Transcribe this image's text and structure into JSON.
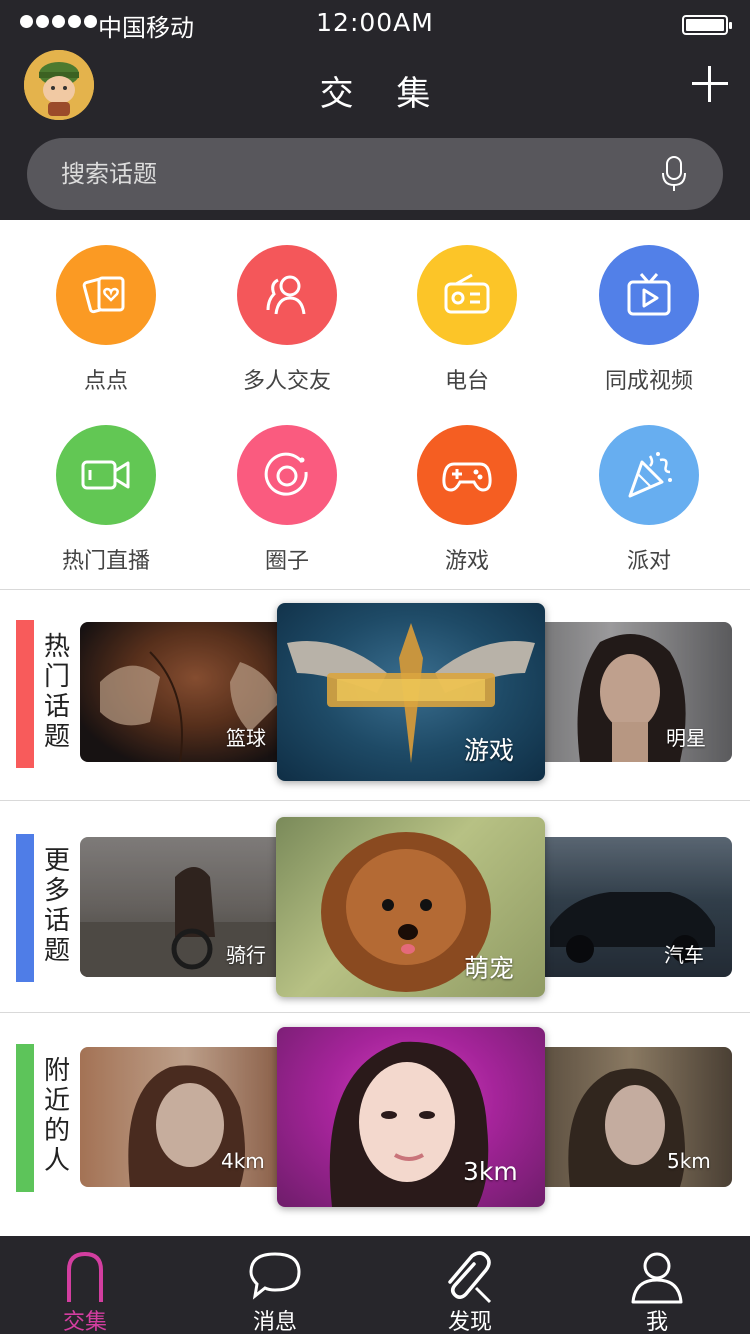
{
  "status_bar": {
    "carrier": "中国移动",
    "time": "12:00AM"
  },
  "header": {
    "title": "交 集"
  },
  "search": {
    "placeholder": "搜索话题"
  },
  "categories": [
    {
      "label": "点点",
      "icon": "heart-card-icon",
      "color": "#fb9a23"
    },
    {
      "label": "多人交友",
      "icon": "people-icon",
      "color": "#f4575a"
    },
    {
      "label": "电台",
      "icon": "radio-icon",
      "color": "#fcc528"
    },
    {
      "label": "同成视频",
      "icon": "tv-play-icon",
      "color": "#5280e8"
    },
    {
      "label": "热门直播",
      "icon": "video-camera-icon",
      "color": "#62c754"
    },
    {
      "label": "圈子",
      "icon": "circle-icon",
      "color": "#fa5b7f"
    },
    {
      "label": "游戏",
      "icon": "gamepad-icon",
      "color": "#f55e22"
    },
    {
      "label": "派对",
      "icon": "party-popper-icon",
      "color": "#67aef0"
    }
  ],
  "sections": [
    {
      "title": "热门话题",
      "color": "#f85b5b",
      "left": {
        "caption": "篮球"
      },
      "center": {
        "caption": "游戏"
      },
      "right": {
        "caption": "明星"
      }
    },
    {
      "title": "更多话题",
      "color": "#4f7de7",
      "left": {
        "caption": "骑行"
      },
      "center": {
        "caption": "萌宠"
      },
      "right": {
        "caption": "汽车"
      }
    },
    {
      "title": "附近的人",
      "color": "#5dc45a",
      "left": {
        "caption": "4km"
      },
      "center": {
        "caption": "3km"
      },
      "right": {
        "caption": "5km"
      }
    }
  ],
  "tabs": [
    {
      "label": "交集",
      "active": true
    },
    {
      "label": "消息",
      "active": false
    },
    {
      "label": "发现",
      "active": false
    },
    {
      "label": "我",
      "active": false
    }
  ],
  "colors": {
    "header_bg": "#27262b",
    "accent": "#d33ea0"
  }
}
